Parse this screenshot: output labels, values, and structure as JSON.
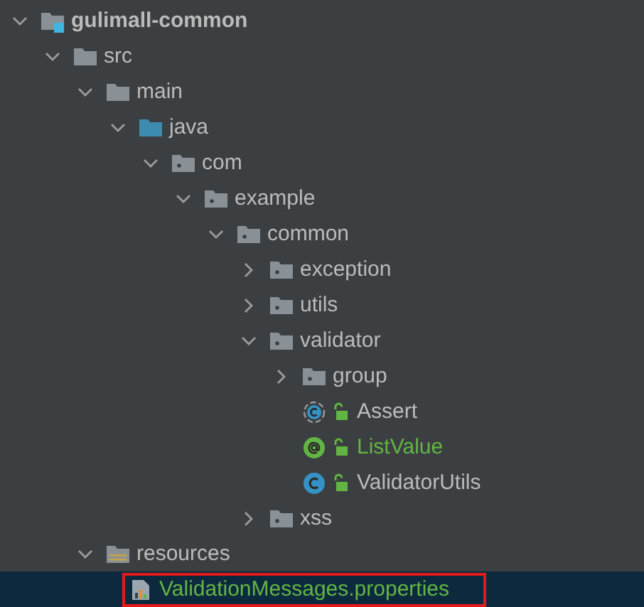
{
  "tree": [
    {
      "label": "gulimall-common",
      "kind": "module",
      "expanded": true,
      "selected": false,
      "vcs_added": false,
      "children": [
        {
          "label": "src",
          "kind": "folder",
          "expanded": true,
          "selected": false,
          "vcs_added": false,
          "children": [
            {
              "label": "main",
              "kind": "folder",
              "expanded": true,
              "selected": false,
              "vcs_added": false,
              "children": [
                {
                  "label": "java",
                  "kind": "source-folder",
                  "expanded": true,
                  "selected": false,
                  "vcs_added": false,
                  "children": [
                    {
                      "label": "com",
                      "kind": "package",
                      "expanded": true,
                      "selected": false,
                      "vcs_added": false,
                      "children": [
                        {
                          "label": "example",
                          "kind": "package",
                          "expanded": true,
                          "selected": false,
                          "vcs_added": false,
                          "children": [
                            {
                              "label": "common",
                              "kind": "package",
                              "expanded": true,
                              "selected": false,
                              "vcs_added": false,
                              "children": [
                                {
                                  "label": "exception",
                                  "kind": "package",
                                  "expanded": false,
                                  "selected": false,
                                  "vcs_added": false
                                },
                                {
                                  "label": "utils",
                                  "kind": "package",
                                  "expanded": false,
                                  "selected": false,
                                  "vcs_added": false
                                },
                                {
                                  "label": "validator",
                                  "kind": "package",
                                  "expanded": true,
                                  "selected": false,
                                  "vcs_added": false,
                                  "children": [
                                    {
                                      "label": "group",
                                      "kind": "package",
                                      "expanded": false,
                                      "selected": false,
                                      "vcs_added": false
                                    },
                                    {
                                      "label": "Assert",
                                      "kind": "abstract-class",
                                      "selected": false,
                                      "vcs_added": false
                                    },
                                    {
                                      "label": "ListValue",
                                      "kind": "annotation",
                                      "selected": false,
                                      "vcs_added": true
                                    },
                                    {
                                      "label": "ValidatorUtils",
                                      "kind": "class",
                                      "selected": false,
                                      "vcs_added": false
                                    }
                                  ]
                                },
                                {
                                  "label": "xss",
                                  "kind": "package",
                                  "expanded": false,
                                  "selected": false,
                                  "vcs_added": false
                                }
                              ]
                            }
                          ]
                        }
                      ]
                    }
                  ]
                }
              ]
            },
            {
              "label": "resources",
              "kind": "resources-folder",
              "expanded": true,
              "selected": false,
              "vcs_added": false,
              "children": [
                {
                  "label": "ValidationMessages.properties",
                  "kind": "properties",
                  "selected": true,
                  "vcs_added": true,
                  "highlighted": true
                }
              ]
            }
          ]
        }
      ]
    }
  ]
}
